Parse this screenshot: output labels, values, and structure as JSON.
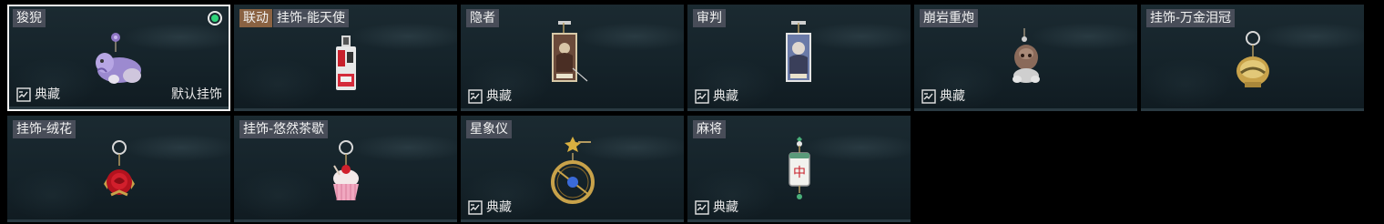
{
  "cards": [
    {
      "name": "狻猊",
      "collab": "",
      "selected": true,
      "equipped": true,
      "collection": "典藏",
      "default_label": "默认挂饰"
    },
    {
      "name": "挂饰-能天使",
      "collab": "联动",
      "selected": false,
      "equipped": false,
      "collection": "",
      "default_label": ""
    },
    {
      "name": "隐者",
      "collab": "",
      "selected": false,
      "equipped": false,
      "collection": "典藏",
      "default_label": ""
    },
    {
      "name": "审判",
      "collab": "",
      "selected": false,
      "equipped": false,
      "collection": "典藏",
      "default_label": ""
    },
    {
      "name": "崩岩重炮",
      "collab": "",
      "selected": false,
      "equipped": false,
      "collection": "典藏",
      "default_label": ""
    },
    {
      "name": "挂饰-万金泪冠",
      "collab": "",
      "selected": false,
      "equipped": false,
      "collection": "",
      "default_label": ""
    },
    {
      "name": "挂饰-绒花",
      "collab": "",
      "selected": false,
      "equipped": false,
      "collection": "",
      "default_label": ""
    },
    {
      "name": "挂饰-悠然茶歇",
      "collab": "",
      "selected": false,
      "equipped": false,
      "collection": "",
      "default_label": ""
    },
    {
      "name": "星象仪",
      "collab": "",
      "selected": false,
      "equipped": false,
      "collection": "典藏",
      "default_label": ""
    },
    {
      "name": "麻将",
      "collab": "",
      "selected": false,
      "equipped": false,
      "collection": "典藏",
      "default_label": ""
    }
  ],
  "colors": {
    "collab_tag": "#8a6242",
    "equipped_dot": "#2fd37a",
    "selected_border": "#f2f2f2"
  },
  "icons": {
    "equipped": "radio-dot-icon",
    "collection": "collection-stamp-icon",
    "charms": [
      "qilin-lion-charm-icon",
      "angel-charm-icon",
      "hermit-tarot-charm-icon",
      "judgement-tarot-charm-icon",
      "rock-creature-charm-icon",
      "gold-crown-charm-icon",
      "red-rose-charm-icon",
      "cupcake-charm-icon",
      "astrolabe-charm-icon",
      "mahjong-tile-charm-icon"
    ]
  }
}
